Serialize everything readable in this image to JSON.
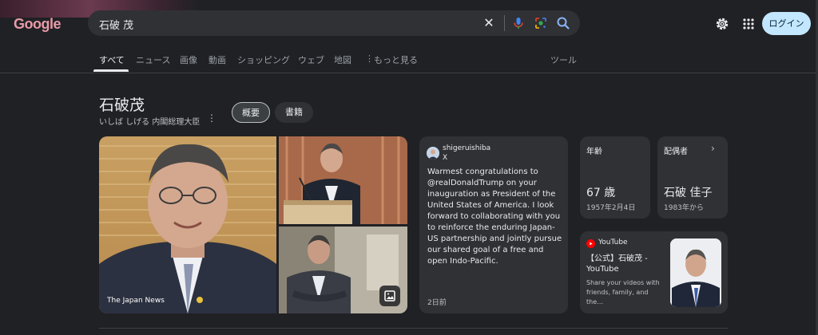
{
  "header": {
    "logo": "Google",
    "search_query": "石破 茂",
    "login_label": "ログイン"
  },
  "tabs": [
    {
      "label": "すべて",
      "active": true
    },
    {
      "label": "ニュース"
    },
    {
      "label": "画像"
    },
    {
      "label": "動画"
    },
    {
      "label": "ショッピング"
    },
    {
      "label": "ウェブ"
    },
    {
      "label": "地図"
    },
    {
      "label": "もっと見る"
    },
    {
      "label": "ツール"
    }
  ],
  "entity": {
    "title": "石破茂",
    "subtitle": "いしば しげる  内閣総理大臣",
    "chips": [
      "概要",
      "書籍"
    ]
  },
  "images": {
    "caption": "The Japan News"
  },
  "tweet": {
    "handle": "shigeruishiba",
    "source": "X",
    "body": "Warmest congratulations to @realDonaldTrump on your inauguration as President of the United States of America. I look forward to collaborating with you to reinforce the enduring Japan-US partnership and jointly pursue our shared goal of a free and open Indo-Pacific.",
    "time": "2日前"
  },
  "facts": {
    "age": {
      "label": "年齢",
      "value": "67 歳",
      "sub": "1957年2月4日"
    },
    "spouse": {
      "label": "配偶者",
      "value": "石破 佳子",
      "sub": "1983年から"
    }
  },
  "youtube": {
    "source": "YouTube",
    "title": "【公式】石破茂 - YouTube",
    "description": "Share your videos with friends, family, and the…"
  },
  "colors": {
    "background": "#202124",
    "card": "#303134",
    "login_button": "#c2e7ff",
    "youtube_red": "#ff0000"
  }
}
